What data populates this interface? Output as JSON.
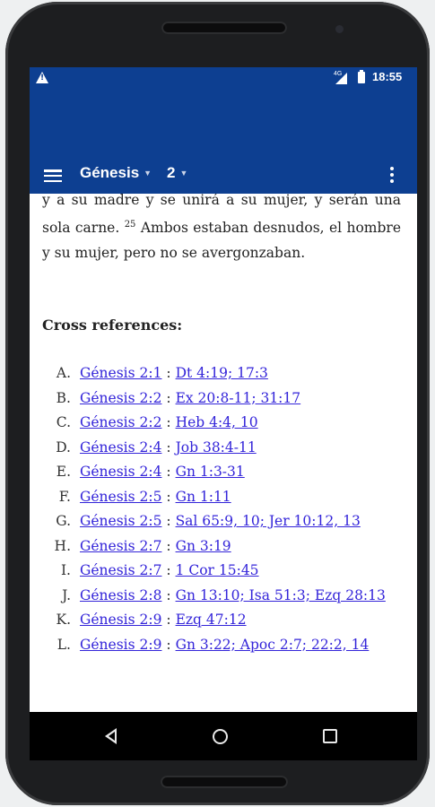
{
  "status_bar": {
    "network": "4G",
    "time": "18:55",
    "icons": [
      "warning-icon",
      "signal-icon",
      "battery-icon"
    ]
  },
  "app_bar": {
    "book": "Génesis",
    "chapter": "2",
    "icons": [
      "menu-icon",
      "dropdown-caret-icon",
      "overflow-menu-icon"
    ]
  },
  "verse": {
    "text_a": "y a su madre y se unirá a su mujer, y serán una sola carne.",
    "number": "25",
    "text_b": "Ambos estaban desnudos, el hombre y su mujer, pero no se avergonzaban."
  },
  "cross_references": {
    "heading": "Cross references:",
    "separator": ":",
    "items": [
      {
        "letter": "A.",
        "source": "Génesis 2:1",
        "target": "Dt 4:19; 17:3"
      },
      {
        "letter": "B.",
        "source": "Génesis 2:2",
        "target": "Ex 20:8-11; 31:17"
      },
      {
        "letter": "C.",
        "source": "Génesis 2:2",
        "target": "Heb 4:4, 10"
      },
      {
        "letter": "D.",
        "source": "Génesis 2:4",
        "target": "Job 38:4-11"
      },
      {
        "letter": "E.",
        "source": "Génesis 2:4",
        "target": "Gn 1:3-31"
      },
      {
        "letter": "F.",
        "source": "Génesis 2:5",
        "target": "Gn 1:11"
      },
      {
        "letter": "G.",
        "source": "Génesis 2:5",
        "target": "Sal 65:9, 10; Jer 10:12, 13"
      },
      {
        "letter": "H.",
        "source": "Génesis 2:7",
        "target": "Gn 3:19"
      },
      {
        "letter": "I.",
        "source": "Génesis 2:7",
        "target": "1 Cor 15:45"
      },
      {
        "letter": "J.",
        "source": "Génesis 2:8",
        "target": "Gn 13:10; Isa 51:3; Ezq 28:13"
      },
      {
        "letter": "K.",
        "source": "Génesis 2:9",
        "target": "Ezq 47:12"
      },
      {
        "letter": "L.",
        "source": "Génesis 2:9",
        "target": "Gn 3:22; Apoc 2:7; 22:2, 14"
      }
    ]
  },
  "navigation_bar": {
    "icons": [
      "back-icon",
      "home-icon",
      "recent-apps-icon"
    ]
  },
  "colors": {
    "app_bar": "#0d3f91",
    "link": "#3324d9",
    "text": "#222222"
  }
}
